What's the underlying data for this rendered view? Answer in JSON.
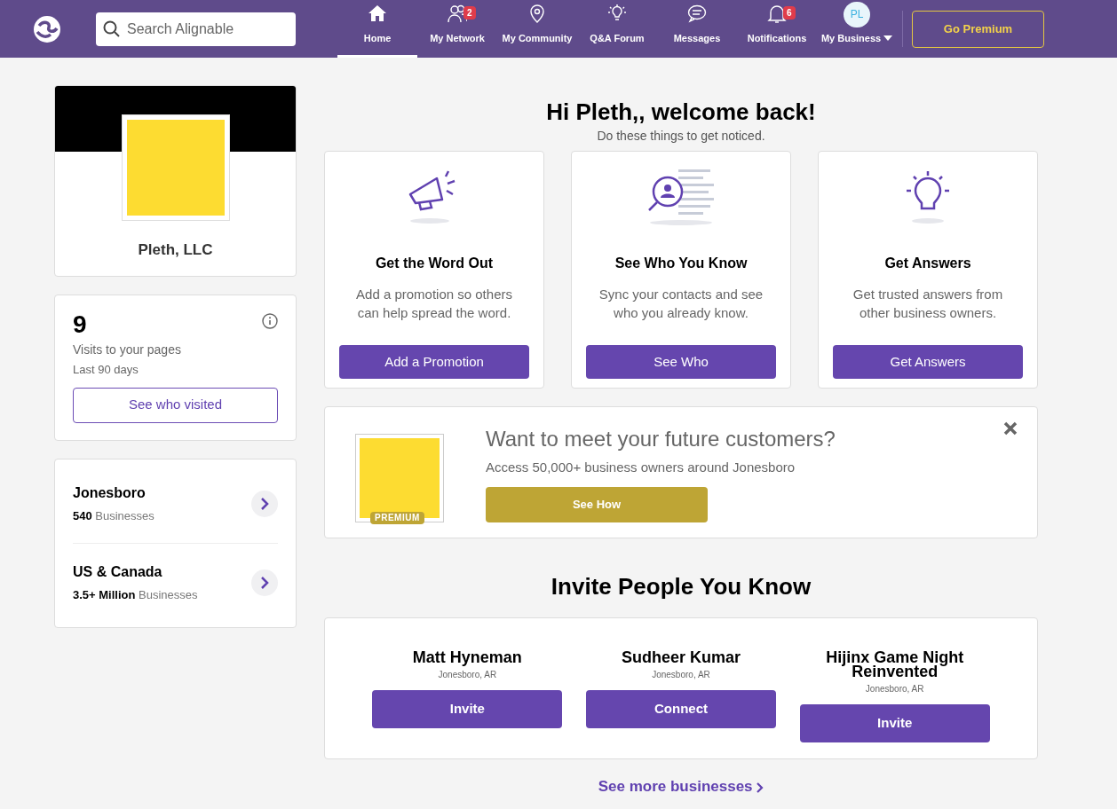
{
  "header": {
    "search": {
      "placeholder": "Search Alignable"
    },
    "nav": [
      {
        "kind": "home",
        "label": "Home",
        "selected": true
      },
      {
        "kind": "network",
        "label": "My Network",
        "selected": false,
        "badge": "2"
      },
      {
        "kind": "community",
        "label": "My Community",
        "selected": false
      },
      {
        "kind": "forum",
        "label": "Q&A Forum",
        "selected": false
      },
      {
        "kind": "messages",
        "label": "Messages",
        "selected": false
      },
      {
        "kind": "notifications",
        "label": "Notifications",
        "selected": false,
        "badge": "6"
      },
      {
        "kind": "business",
        "label": "My Business",
        "selected": false,
        "avatar": "PL"
      }
    ],
    "premium_button": "Go Premium"
  },
  "profile": {
    "name": "Pleth, LLC"
  },
  "visits": {
    "count": "9",
    "label": "Visits to your pages",
    "period": "Last 90 days",
    "button": "See who visited"
  },
  "areas": [
    {
      "name": "Jonesboro",
      "count": "540",
      "unit": "Businesses"
    },
    {
      "name": "US & Canada",
      "count": "3.5+ Million",
      "unit": "Businesses"
    }
  ],
  "welcome": {
    "title": "Hi Pleth,, welcome back!",
    "subtitle": "Do these things to get noticed."
  },
  "tasks": [
    {
      "kind": "megaphone",
      "title": "Get the Word Out",
      "text": "Add a promotion so others can help spread the word.",
      "button": "Add a Promotion"
    },
    {
      "kind": "contacts",
      "title": "See Who You Know",
      "text": "Sync your contacts and see who you already know.",
      "button": "See Who"
    },
    {
      "kind": "bulb",
      "title": "Get Answers",
      "text": "Get trusted answers from other business owners.",
      "button": "Get Answers"
    }
  ],
  "promo": {
    "badge": "PREMIUM",
    "title": "Want to meet your future customers?",
    "text": "Access 50,000+ business owners around Jonesboro",
    "button": "See How"
  },
  "invite": {
    "title": "Invite People You Know",
    "people": [
      {
        "name": "Matt Hyneman",
        "location": "Jonesboro, AR",
        "button": "Invite"
      },
      {
        "name": "Sudheer Kumar",
        "location": "Jonesboro, AR",
        "button": "Connect"
      },
      {
        "name": "Hijinx Game Night Reinvented",
        "location": "Jonesboro, AR",
        "button": "Invite"
      }
    ],
    "more_link": "See more businesses"
  }
}
